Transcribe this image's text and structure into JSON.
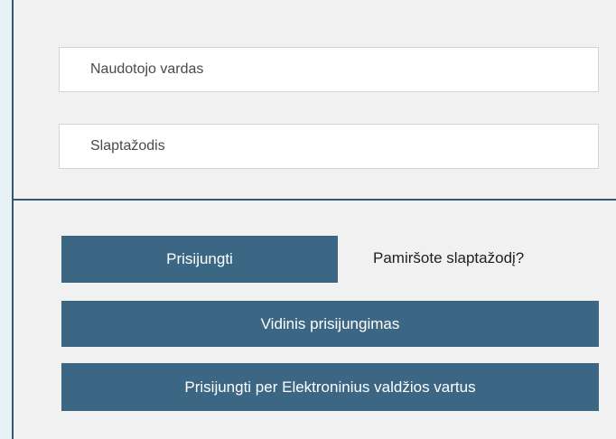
{
  "login_form": {
    "username": {
      "placeholder": "Naudotojo vardas",
      "value": ""
    },
    "password": {
      "placeholder": "Slaptažodis",
      "value": ""
    },
    "login_label": "Prisijungti",
    "forgot_password_label": "Pamiršote slaptažodį?",
    "internal_login_label": "Vidinis prisijungimas",
    "evv_login_label": "Prisijungti per Elektroninius valdžios vartus"
  },
  "colors": {
    "page_background": "#e8f1f4",
    "panel_background": "#f1f1f1",
    "accent_border": "#365872",
    "button_background": "#3c6784",
    "button_text": "#ffffff"
  }
}
